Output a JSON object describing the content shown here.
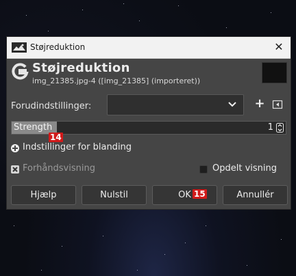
{
  "window": {
    "title": "Støjreduktion",
    "close_glyph": "✕"
  },
  "header": {
    "title": "Støjreduktion",
    "subtitle": "img_21385.jpg-4 ([img_21385] (importeret))",
    "icon": "gegl-g-icon"
  },
  "presets": {
    "label": "Forudindstillinger:",
    "value": "",
    "add_glyph": "+"
  },
  "strength": {
    "label": "Strength",
    "value": "1",
    "level_fraction": 0.166
  },
  "blend": {
    "label": "Indstillinger for blanding"
  },
  "preview": {
    "label": "Forhåndsvisning",
    "checked": true
  },
  "split": {
    "label": "Opdelt visning",
    "checked": false
  },
  "buttons": {
    "help": "Hjælp",
    "reset": "Nulstil",
    "ok": "OK",
    "cancel": "Annullér"
  },
  "badges": {
    "strength": "14",
    "ok": "15"
  },
  "colors": {
    "badge": "#d11a1a",
    "dialog_bg": "#454545"
  }
}
